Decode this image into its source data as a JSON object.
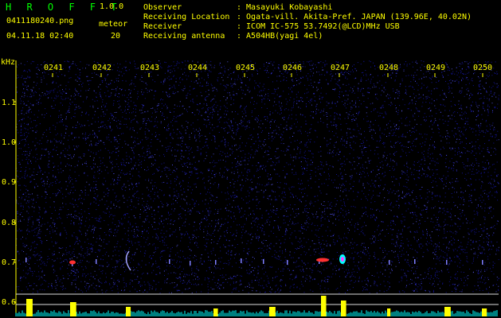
{
  "header": {
    "app_title": "H R O F F T",
    "version": "1.0.0",
    "filename": "0411180240.png",
    "meteor_label": "meteor",
    "datetime": "04.11.18 02:40",
    "meteor_count": "20"
  },
  "info": [
    {
      "label": "Observer",
      "value": ": Masayuki Kobayashi"
    },
    {
      "label": "Receiving Location",
      "value": ": Ogata-vill. Akita-Pref. JAPAN (139.96E, 40.02N)"
    },
    {
      "label": "Receiver",
      "value": ": ICOM IC-575 53.7492(@LCD)MHz USB"
    },
    {
      "label": "Receiving antenna",
      "value": ": A504HB(yagi 4el)"
    }
  ],
  "chart_data": {
    "type": "heatmap",
    "ylabel": "kHz",
    "y_ticks": [
      "1.1",
      "1.0",
      "0.9",
      "0.8",
      "0.7",
      "0.6"
    ],
    "x_ticks": [
      "0241",
      "0242",
      "0243",
      "0244",
      "0245",
      "0246",
      "0247",
      "0248",
      "0249",
      "0250"
    ],
    "colors": {
      "background": "#000000",
      "noise": "#1a1ac8",
      "signal": "#ff3030",
      "strong": "#00ffff",
      "tick_text": "#ffff00",
      "title_text": "#00ff00"
    }
  }
}
